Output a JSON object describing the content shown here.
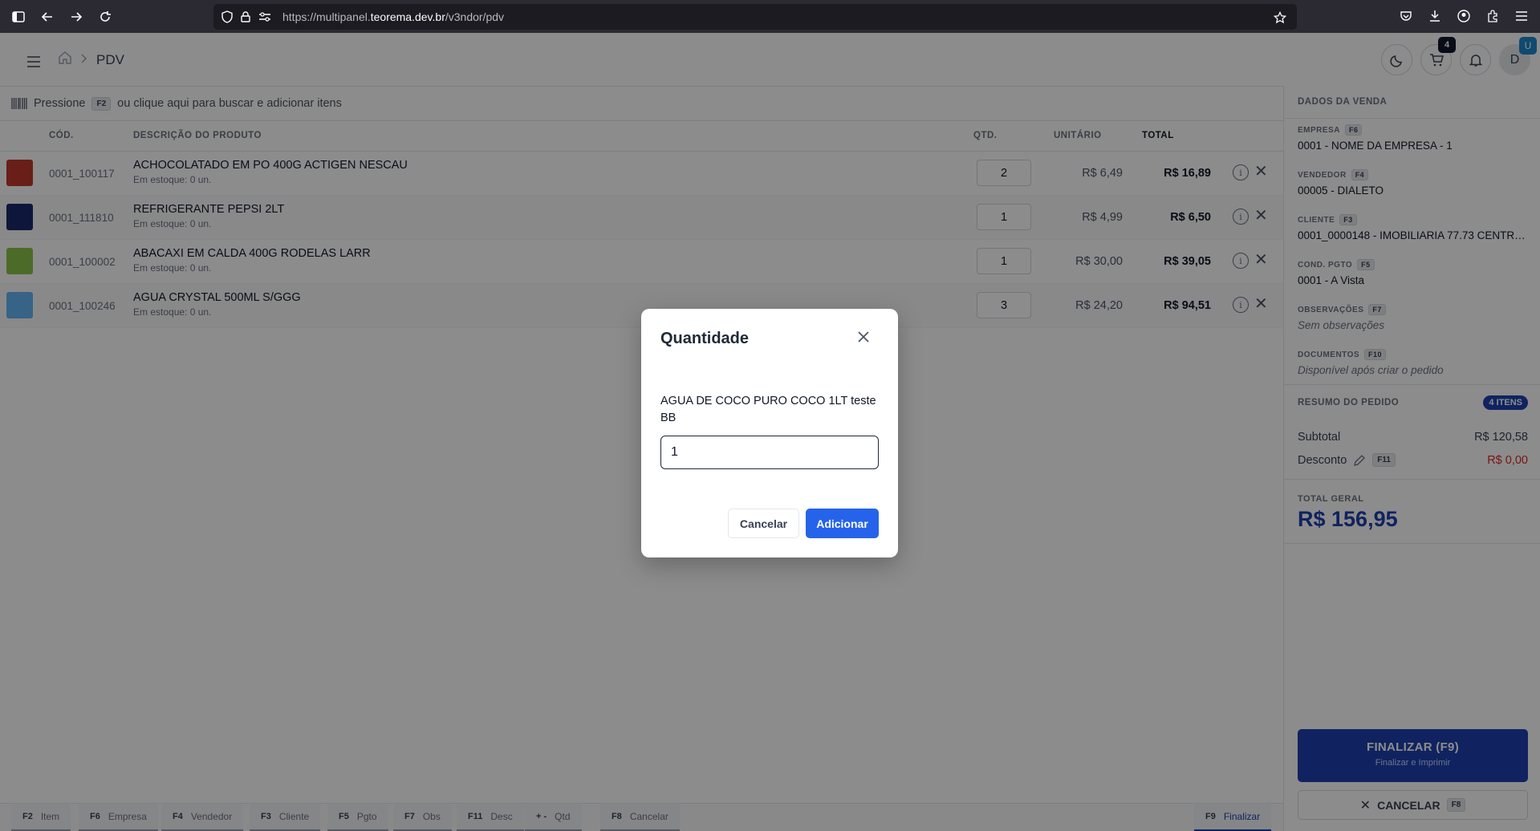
{
  "browser": {
    "url_prefix": "https://multipanel.",
    "url_host": "teorema.dev.br",
    "url_path": "/v3ndor/pdv"
  },
  "header": {
    "breadcrumb_page": "PDV",
    "cart_count": "4",
    "avatar_initial": "D",
    "avatar_badge": "U"
  },
  "search": {
    "prefix": "Pressione",
    "key": "F2",
    "suffix": "ou clique aqui para buscar e adicionar itens"
  },
  "table": {
    "headers": {
      "code": "CÓD.",
      "description": "DESCRIÇÃO DO PRODUTO",
      "qty": "QTD.",
      "unit": "UNITÁRIO",
      "total": "TOTAL"
    },
    "rows": [
      {
        "code": "0001_100117",
        "name": "ACHOCOLATADO EM PO 400G ACTIGEN NESCAU",
        "stock": "Em estoque: 0 un.",
        "qty": "2",
        "unit": "R$ 6,49",
        "total": "R$ 16,89",
        "thumb_color": "#c0392b"
      },
      {
        "code": "0001_111810",
        "name": "REFRIGERANTE PEPSI 2LT",
        "stock": "Em estoque: 0 un.",
        "qty": "1",
        "unit": "R$ 4,99",
        "total": "R$ 6,50",
        "thumb_color": "#1a2a6c"
      },
      {
        "code": "0001_100002",
        "name": "ABACAXI EM CALDA 400G RODELAS LARR",
        "stock": "Em estoque: 0 un.",
        "qty": "1",
        "unit": "R$ 30,00",
        "total": "R$ 39,05",
        "thumb_color": "#8bc34a"
      },
      {
        "code": "0001_100246",
        "name": "AGUA CRYSTAL 500ML S/GGG",
        "stock": "Em estoque: 0 un.",
        "qty": "3",
        "unit": "R$ 24,20",
        "total": "R$ 94,51",
        "thumb_color": "#64b5f6"
      }
    ]
  },
  "sale": {
    "title": "DADOS DA VENDA",
    "empresa": {
      "label": "EMPRESA",
      "key": "F6",
      "value": "0001 - NOME DA EMPRESA - 1"
    },
    "vendedor": {
      "label": "VENDEDOR",
      "key": "F4",
      "value": "00005 - DIALETO"
    },
    "cliente": {
      "label": "CLIENTE",
      "key": "F3",
      "value": "0001_0000148 - IMOBILIARIA 77.73 CENTRO ..."
    },
    "pgto": {
      "label": "COND. PGTO",
      "key": "F5",
      "value": "0001 - A Vista"
    },
    "obs": {
      "label": "OBSERVAÇÕES",
      "key": "F7",
      "value": "Sem observações"
    },
    "docs": {
      "label": "DOCUMENTOS",
      "key": "F10",
      "value": "Disponível após criar o pedido"
    }
  },
  "summary": {
    "title": "RESUMO DO PEDIDO",
    "items_badge": "4 ITENS",
    "subtotal_label": "Subtotal",
    "subtotal_value": "R$ 120,58",
    "discount_label": "Desconto",
    "discount_key": "F11",
    "discount_value": "R$ 0,00",
    "total_label": "TOTAL GERAL",
    "total_value": "R$ 156,95"
  },
  "actions": {
    "finalize_main": "FINALIZAR (F9)",
    "finalize_sub": "Finalizar e Imprimir",
    "cancel_label": "CANCELAR",
    "cancel_key": "F8"
  },
  "footer": {
    "keys": [
      {
        "key": "F2",
        "label": "Item"
      },
      {
        "key": "F6",
        "label": "Empresa"
      },
      {
        "key": "F4",
        "label": "Vendedor"
      },
      {
        "key": "F3",
        "label": "Cliente"
      },
      {
        "key": "F5",
        "label": "Pgto"
      },
      {
        "key": "F7",
        "label": "Obs"
      },
      {
        "key": "F11",
        "label": "Desc"
      },
      {
        "key": "+ -",
        "label": "Qtd"
      },
      {
        "key": "F8",
        "label": "Cancelar"
      }
    ],
    "finalize": {
      "key": "F9",
      "label": "Finalizar"
    }
  },
  "modal": {
    "title": "Quantidade",
    "product": "AGUA DE COCO PURO COCO 1LT teste BB",
    "input_value": "1",
    "cancel_label": "Cancelar",
    "add_label": "Adicionar"
  },
  "colors": {
    "primary": "#1e40af",
    "accent_button": "#2563eb",
    "danger": "#dc2626",
    "overlay": "rgba(0,0,0,0.45)"
  }
}
